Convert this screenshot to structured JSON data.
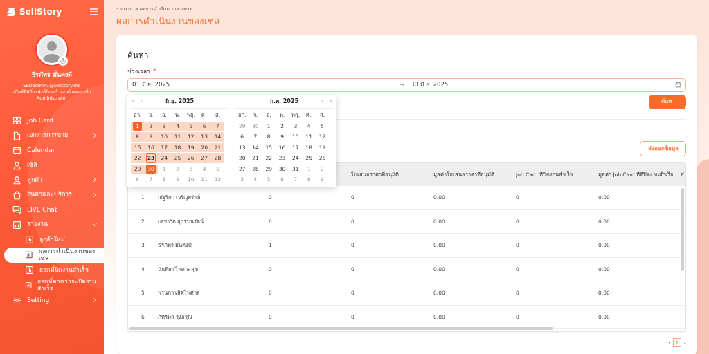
{
  "sidebar": {
    "brand": "SellStory",
    "profile": {
      "name": "ธีรภัทร มั่นคงดี",
      "email": "SEOadmin1@sellstory.me",
      "company": "สไตล์ลิฟวิ่ง เฟอร์นิเจอร์ แอนด์ เดคอเรชั่น",
      "role": "Administrator"
    },
    "menu": [
      {
        "label": "Job Card",
        "has_submenu": false
      },
      {
        "label": "เอกสารการขาย",
        "has_submenu": true,
        "expanded": false
      },
      {
        "label": "Calendar",
        "has_submenu": false
      },
      {
        "label": "เซล",
        "has_submenu": false
      },
      {
        "label": "ลูกค้า",
        "has_submenu": true,
        "expanded": false
      },
      {
        "label": "สินค้าและบริการ",
        "has_submenu": true,
        "expanded": false
      },
      {
        "label": "LIVE Chat",
        "has_submenu": false
      },
      {
        "label": "รายงาน",
        "has_submenu": true,
        "expanded": true,
        "children": [
          {
            "label": "ลูกค้าใหม่",
            "selected": false
          },
          {
            "label": "ผลการดำเนินงานของเซล",
            "selected": true
          },
          {
            "label": "ยอดที่ปิดงานสำเร็จ",
            "selected": false
          },
          {
            "label": "ยอดที่คาดว่าจะปิดงานสำเร็จ",
            "selected": false
          }
        ]
      },
      {
        "label": "Setting",
        "has_submenu": true,
        "expanded": false
      }
    ]
  },
  "breadcrumb": {
    "items": [
      "รายงาน",
      "ผลการดำเนินงานของเซล"
    ],
    "separator": ">"
  },
  "page_title": "ผลการดำเนินงานของเซล",
  "search": {
    "heading": "ค้นหา",
    "label": "ช่วงเวลา",
    "required_mark": "*",
    "start": "01 มิ.ย. 2025",
    "arrow": "→",
    "end": "30 มิ.ย. 2025",
    "button": "ค้นหา"
  },
  "calendar": {
    "nav_prev": [
      "«",
      "‹"
    ],
    "nav_next": [
      "›",
      "»"
    ],
    "months": [
      {
        "title": "มิ.ย.  2025",
        "weekdays": [
          "อา.",
          "จ.",
          "อ.",
          "พ.",
          "พฤ.",
          "ศ.",
          "ส."
        ],
        "days": [
          {
            "day": "1",
            "kind": "range_end"
          },
          {
            "day": "2",
            "kind": "range"
          },
          {
            "day": "3",
            "kind": "range"
          },
          {
            "day": "4",
            "kind": "range"
          },
          {
            "day": "5",
            "kind": "range"
          },
          {
            "day": "6",
            "kind": "range"
          },
          {
            "day": "7",
            "kind": "range"
          },
          {
            "day": "8",
            "kind": "range"
          },
          {
            "day": "9",
            "kind": "range"
          },
          {
            "day": "10",
            "kind": "range"
          },
          {
            "day": "11",
            "kind": "range"
          },
          {
            "day": "12",
            "kind": "range"
          },
          {
            "day": "13",
            "kind": "range"
          },
          {
            "day": "14",
            "kind": "range"
          },
          {
            "day": "15",
            "kind": "range"
          },
          {
            "day": "16",
            "kind": "range"
          },
          {
            "day": "17",
            "kind": "range"
          },
          {
            "day": "18",
            "kind": "range"
          },
          {
            "day": "19",
            "kind": "range"
          },
          {
            "day": "20",
            "kind": "range"
          },
          {
            "day": "21",
            "kind": "range"
          },
          {
            "day": "22",
            "kind": "range"
          },
          {
            "day": "23",
            "kind": "today"
          },
          {
            "day": "24",
            "kind": "range"
          },
          {
            "day": "25",
            "kind": "range"
          },
          {
            "day": "26",
            "kind": "range"
          },
          {
            "day": "27",
            "kind": "range"
          },
          {
            "day": "28",
            "kind": "range"
          },
          {
            "day": "29",
            "kind": "range"
          },
          {
            "day": "30",
            "kind": "range_end"
          },
          {
            "day": "1",
            "kind": "outside"
          },
          {
            "day": "2",
            "kind": "outside"
          },
          {
            "day": "3",
            "kind": "outside"
          },
          {
            "day": "4",
            "kind": "outside"
          },
          {
            "day": "5",
            "kind": "outside"
          },
          {
            "day": "6",
            "kind": "outside"
          },
          {
            "day": "7",
            "kind": "outside"
          },
          {
            "day": "8",
            "kind": "outside"
          },
          {
            "day": "9",
            "kind": "outside"
          },
          {
            "day": "10",
            "kind": "outside"
          },
          {
            "day": "11",
            "kind": "outside"
          },
          {
            "day": "12",
            "kind": "outside"
          }
        ]
      },
      {
        "title": "ก.ค.  2025",
        "weekdays": [
          "อา.",
          "จ.",
          "อ.",
          "พ.",
          "พฤ.",
          "ศ.",
          "ส."
        ],
        "days": [
          {
            "day": "29",
            "kind": "outside"
          },
          {
            "day": "30",
            "kind": "outside"
          },
          {
            "day": "1",
            "kind": "plain"
          },
          {
            "day": "2",
            "kind": "plain"
          },
          {
            "day": "3",
            "kind": "plain"
          },
          {
            "day": "4",
            "kind": "plain"
          },
          {
            "day": "5",
            "kind": "plain"
          },
          {
            "day": "6",
            "kind": "plain"
          },
          {
            "day": "7",
            "kind": "plain"
          },
          {
            "day": "8",
            "kind": "plain"
          },
          {
            "day": "9",
            "kind": "plain"
          },
          {
            "day": "10",
            "kind": "plain"
          },
          {
            "day": "11",
            "kind": "plain"
          },
          {
            "day": "12",
            "kind": "plain"
          },
          {
            "day": "13",
            "kind": "plain"
          },
          {
            "day": "14",
            "kind": "plain"
          },
          {
            "day": "15",
            "kind": "plain"
          },
          {
            "day": "16",
            "kind": "plain"
          },
          {
            "day": "17",
            "kind": "plain"
          },
          {
            "day": "18",
            "kind": "plain"
          },
          {
            "day": "19",
            "kind": "plain"
          },
          {
            "day": "20",
            "kind": "plain"
          },
          {
            "day": "21",
            "kind": "plain"
          },
          {
            "day": "22",
            "kind": "plain"
          },
          {
            "day": "23",
            "kind": "plain"
          },
          {
            "day": "24",
            "kind": "plain"
          },
          {
            "day": "25",
            "kind": "plain"
          },
          {
            "day": "26",
            "kind": "plain"
          },
          {
            "day": "27",
            "kind": "plain"
          },
          {
            "day": "28",
            "kind": "plain"
          },
          {
            "day": "29",
            "kind": "plain"
          },
          {
            "day": "30",
            "kind": "plain"
          },
          {
            "day": "31",
            "kind": "plain"
          },
          {
            "day": "1",
            "kind": "outside"
          },
          {
            "day": "2",
            "kind": "outside"
          },
          {
            "day": "3",
            "kind": "outside"
          },
          {
            "day": "4",
            "kind": "outside"
          },
          {
            "day": "5",
            "kind": "outside"
          },
          {
            "day": "6",
            "kind": "outside"
          },
          {
            "day": "7",
            "kind": "outside"
          },
          {
            "day": "8",
            "kind": "outside"
          },
          {
            "day": "9",
            "kind": "outside"
          }
        ]
      }
    ]
  },
  "export_button": "ส่งออกข้อมูล",
  "table": {
    "columns": [
      {},
      {},
      {},
      {
        "label": "ใบเสนอราคาที่อนุมัติ"
      },
      {
        "label": "มูลค่าใบเสนอราคาที่อนุมัติ"
      },
      {
        "label": "Job Card ที่ปิดงานสำเร็จ"
      },
      {
        "label": "มูลค่า Job Card ที่ที่ปิดงานสำเร็จ"
      },
      {
        "label": "ส่"
      }
    ],
    "rows": [
      [
        "1",
        "ณัฐริกา เจริญทรัพย์",
        "0",
        "0",
        "0.00",
        "0",
        "0.00"
      ],
      [
        "2",
        "เดชาวัต สุวรรณรัตน์",
        "0",
        "0",
        "0.00",
        "0",
        "0.00"
      ],
      [
        "3",
        "ธีรภัทร มั่นคงดี",
        "1",
        "0",
        "0.00",
        "0",
        "0.00"
      ],
      [
        "4",
        "นันทิยา ไพศาลสุข",
        "0",
        "0",
        "0.00",
        "0",
        "0.00"
      ],
      [
        "5",
        "พรนภา เลิศไพศาล",
        "0",
        "0",
        "0.00",
        "0",
        "0.00"
      ],
      [
        "6",
        "ภัทรพล รุ่งอรุณ",
        "0",
        "0",
        "0.00",
        "0",
        "0.00"
      ]
    ]
  },
  "pagination": {
    "prev": "‹",
    "next": "›",
    "pages": [
      {
        "label": "1",
        "selected": true
      }
    ]
  }
}
